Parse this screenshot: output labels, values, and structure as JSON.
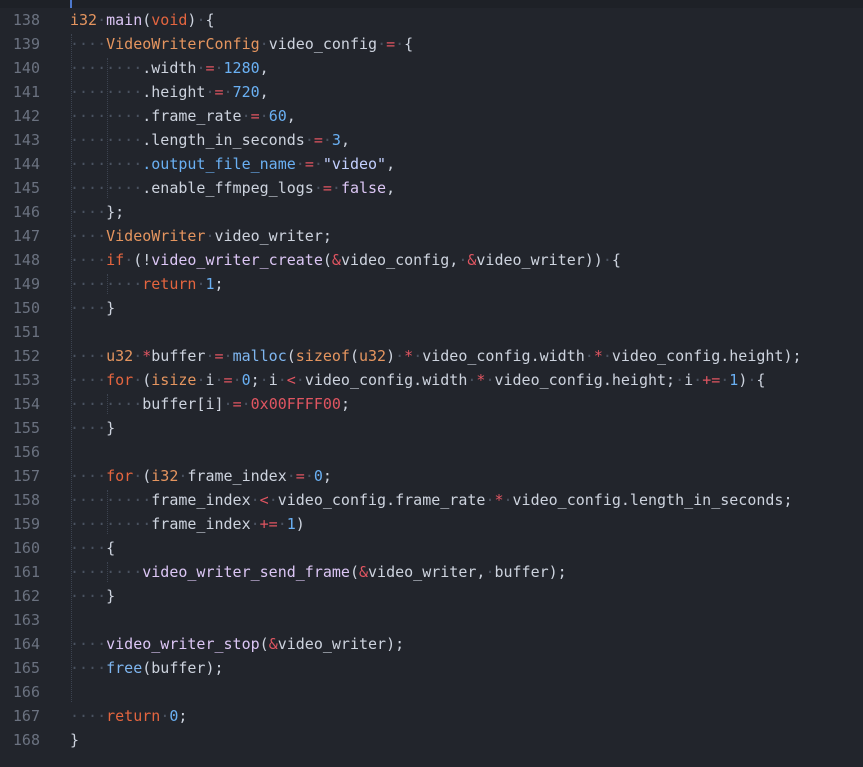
{
  "editor": {
    "lines": [
      {
        "num": "138",
        "tokens": [
          [
            "type",
            "i32"
          ],
          [
            "ws",
            "·"
          ],
          [
            "fn",
            "main"
          ],
          [
            "p",
            "("
          ],
          [
            "kw",
            "void"
          ],
          [
            "p",
            ")"
          ],
          [
            "ws",
            "·"
          ],
          [
            "p",
            "{"
          ]
        ]
      },
      {
        "num": "139",
        "tokens": [
          [
            "ws",
            "····"
          ],
          [
            "type",
            "VideoWriterConfig"
          ],
          [
            "ws",
            "·"
          ],
          [
            "id",
            "video_config"
          ],
          [
            "ws",
            "·"
          ],
          [
            "op",
            "="
          ],
          [
            "ws",
            "·"
          ],
          [
            "p",
            "{"
          ]
        ]
      },
      {
        "num": "140",
        "tokens": [
          [
            "ws",
            "········"
          ],
          [
            "p",
            ".width"
          ],
          [
            "ws",
            "·"
          ],
          [
            "op",
            "="
          ],
          [
            "ws",
            "·"
          ],
          [
            "num",
            "1280"
          ],
          [
            "p",
            ","
          ]
        ]
      },
      {
        "num": "141",
        "tokens": [
          [
            "ws",
            "········"
          ],
          [
            "p",
            ".height"
          ],
          [
            "ws",
            "·"
          ],
          [
            "op",
            "="
          ],
          [
            "ws",
            "·"
          ],
          [
            "num",
            "720"
          ],
          [
            "p",
            ","
          ]
        ]
      },
      {
        "num": "142",
        "tokens": [
          [
            "ws",
            "········"
          ],
          [
            "p",
            ".frame_rate"
          ],
          [
            "ws",
            "·"
          ],
          [
            "op",
            "="
          ],
          [
            "ws",
            "·"
          ],
          [
            "num",
            "60"
          ],
          [
            "p",
            ","
          ]
        ]
      },
      {
        "num": "143",
        "tokens": [
          [
            "ws",
            "········"
          ],
          [
            "p",
            ".length_in_seconds"
          ],
          [
            "ws",
            "·"
          ],
          [
            "op",
            "="
          ],
          [
            "ws",
            "·"
          ],
          [
            "num",
            "3"
          ],
          [
            "p",
            ","
          ]
        ]
      },
      {
        "num": "144",
        "tokens": [
          [
            "ws",
            "········"
          ],
          [
            "field",
            ".output_file_name"
          ],
          [
            "ws",
            "·"
          ],
          [
            "op",
            "="
          ],
          [
            "ws",
            "·"
          ],
          [
            "str",
            "\"video\""
          ],
          [
            "p",
            ","
          ]
        ]
      },
      {
        "num": "145",
        "tokens": [
          [
            "ws",
            "········"
          ],
          [
            "p",
            ".enable_ffmpeg_logs"
          ],
          [
            "ws",
            "·"
          ],
          [
            "op",
            "="
          ],
          [
            "ws",
            "·"
          ],
          [
            "fn",
            "false"
          ],
          [
            "p",
            ","
          ]
        ]
      },
      {
        "num": "146",
        "tokens": [
          [
            "ws",
            "····"
          ],
          [
            "p",
            "};"
          ]
        ]
      },
      {
        "num": "147",
        "tokens": [
          [
            "ws",
            "····"
          ],
          [
            "type",
            "VideoWriter"
          ],
          [
            "ws",
            "·"
          ],
          [
            "id",
            "video_writer;"
          ]
        ]
      },
      {
        "num": "148",
        "tokens": [
          [
            "ws",
            "····"
          ],
          [
            "kw",
            "if"
          ],
          [
            "ws",
            "·"
          ],
          [
            "p",
            "(!"
          ],
          [
            "fn",
            "video_writer_create"
          ],
          [
            "p",
            "("
          ],
          [
            "op",
            "&"
          ],
          [
            "id",
            "video_config,"
          ],
          [
            "ws",
            "·"
          ],
          [
            "op",
            "&"
          ],
          [
            "id",
            "video_writer))"
          ],
          [
            "ws",
            "·"
          ],
          [
            "p",
            "{"
          ]
        ]
      },
      {
        "num": "149",
        "tokens": [
          [
            "ws",
            "········"
          ],
          [
            "kw",
            "return"
          ],
          [
            "ws",
            "·"
          ],
          [
            "num",
            "1"
          ],
          [
            "p",
            ";"
          ]
        ]
      },
      {
        "num": "150",
        "tokens": [
          [
            "ws",
            "····"
          ],
          [
            "p",
            "}"
          ]
        ]
      },
      {
        "num": "151",
        "tokens": []
      },
      {
        "num": "152",
        "tokens": [
          [
            "ws",
            "····"
          ],
          [
            "type",
            "u32"
          ],
          [
            "ws",
            "·"
          ],
          [
            "op",
            "*"
          ],
          [
            "id",
            "buffer"
          ],
          [
            "ws",
            "·"
          ],
          [
            "op",
            "="
          ],
          [
            "ws",
            "·"
          ],
          [
            "builtin",
            "malloc"
          ],
          [
            "p",
            "("
          ],
          [
            "type",
            "sizeof"
          ],
          [
            "p",
            "("
          ],
          [
            "type",
            "u32"
          ],
          [
            "p",
            ")"
          ],
          [
            "ws",
            "·"
          ],
          [
            "op",
            "*"
          ],
          [
            "ws",
            "·"
          ],
          [
            "id",
            "video_config.width"
          ],
          [
            "ws",
            "·"
          ],
          [
            "op",
            "*"
          ],
          [
            "ws",
            "·"
          ],
          [
            "id",
            "video_config.height);"
          ]
        ]
      },
      {
        "num": "153",
        "tokens": [
          [
            "ws",
            "····"
          ],
          [
            "kw",
            "for"
          ],
          [
            "ws",
            "·"
          ],
          [
            "p",
            "("
          ],
          [
            "type",
            "isize"
          ],
          [
            "ws",
            "·"
          ],
          [
            "id",
            "i"
          ],
          [
            "ws",
            "·"
          ],
          [
            "op",
            "="
          ],
          [
            "ws",
            "·"
          ],
          [
            "num",
            "0"
          ],
          [
            "p",
            ";"
          ],
          [
            "ws",
            "·"
          ],
          [
            "id",
            "i"
          ],
          [
            "ws",
            "·"
          ],
          [
            "op",
            "<"
          ],
          [
            "ws",
            "·"
          ],
          [
            "id",
            "video_config.width"
          ],
          [
            "ws",
            "·"
          ],
          [
            "op",
            "*"
          ],
          [
            "ws",
            "·"
          ],
          [
            "id",
            "video_config.height;"
          ],
          [
            "ws",
            "·"
          ],
          [
            "id",
            "i"
          ],
          [
            "ws",
            "·"
          ],
          [
            "op",
            "+="
          ],
          [
            "ws",
            "·"
          ],
          [
            "num",
            "1"
          ],
          [
            "p",
            ")"
          ],
          [
            "ws",
            "·"
          ],
          [
            "p",
            "{"
          ]
        ]
      },
      {
        "num": "154",
        "tokens": [
          [
            "ws",
            "········"
          ],
          [
            "id",
            "buffer[i]"
          ],
          [
            "ws",
            "·"
          ],
          [
            "op",
            "="
          ],
          [
            "ws",
            "·"
          ],
          [
            "op",
            "0x"
          ],
          [
            "op",
            "00FFFF00"
          ],
          [
            "p",
            ";"
          ]
        ]
      },
      {
        "num": "155",
        "tokens": [
          [
            "ws",
            "····"
          ],
          [
            "p",
            "}"
          ]
        ]
      },
      {
        "num": "156",
        "tokens": []
      },
      {
        "num": "157",
        "tokens": [
          [
            "ws",
            "····"
          ],
          [
            "kw",
            "for"
          ],
          [
            "ws",
            "·"
          ],
          [
            "p",
            "("
          ],
          [
            "type",
            "i32"
          ],
          [
            "ws",
            "·"
          ],
          [
            "id",
            "frame_index"
          ],
          [
            "ws",
            "·"
          ],
          [
            "op",
            "="
          ],
          [
            "ws",
            "·"
          ],
          [
            "num",
            "0"
          ],
          [
            "p",
            ";"
          ]
        ]
      },
      {
        "num": "158",
        "tokens": [
          [
            "ws",
            "·········"
          ],
          [
            "id",
            "frame_index"
          ],
          [
            "ws",
            "·"
          ],
          [
            "op",
            "<"
          ],
          [
            "ws",
            "·"
          ],
          [
            "id",
            "video_config.frame_rate"
          ],
          [
            "ws",
            "·"
          ],
          [
            "op",
            "*"
          ],
          [
            "ws",
            "·"
          ],
          [
            "id",
            "video_config.length_in_seconds;"
          ]
        ]
      },
      {
        "num": "159",
        "tokens": [
          [
            "ws",
            "·········"
          ],
          [
            "id",
            "frame_index"
          ],
          [
            "ws",
            "·"
          ],
          [
            "op",
            "+="
          ],
          [
            "ws",
            "·"
          ],
          [
            "num",
            "1"
          ],
          [
            "p",
            ")"
          ]
        ]
      },
      {
        "num": "160",
        "tokens": [
          [
            "ws",
            "····"
          ],
          [
            "p",
            "{"
          ]
        ]
      },
      {
        "num": "161",
        "tokens": [
          [
            "ws",
            "········"
          ],
          [
            "fn",
            "video_writer_send_frame"
          ],
          [
            "p",
            "("
          ],
          [
            "op",
            "&"
          ],
          [
            "id",
            "video_writer,"
          ],
          [
            "ws",
            "·"
          ],
          [
            "id",
            "buffer);"
          ]
        ]
      },
      {
        "num": "162",
        "tokens": [
          [
            "ws",
            "····"
          ],
          [
            "p",
            "}"
          ]
        ]
      },
      {
        "num": "163",
        "tokens": []
      },
      {
        "num": "164",
        "tokens": [
          [
            "ws",
            "····"
          ],
          [
            "fn",
            "video_writer_stop"
          ],
          [
            "p",
            "("
          ],
          [
            "op",
            "&"
          ],
          [
            "id",
            "video_writer);"
          ]
        ]
      },
      {
        "num": "165",
        "tokens": [
          [
            "ws",
            "····"
          ],
          [
            "builtin",
            "free"
          ],
          [
            "p",
            "(buffer);"
          ]
        ]
      },
      {
        "num": "166",
        "tokens": []
      },
      {
        "num": "167",
        "tokens": [
          [
            "ws",
            "····"
          ],
          [
            "kw",
            "return"
          ],
          [
            "ws",
            "·"
          ],
          [
            "num",
            "0"
          ],
          [
            "p",
            ";"
          ]
        ]
      },
      {
        "num": "168",
        "tokens": [
          [
            "p",
            "}"
          ]
        ]
      }
    ]
  }
}
